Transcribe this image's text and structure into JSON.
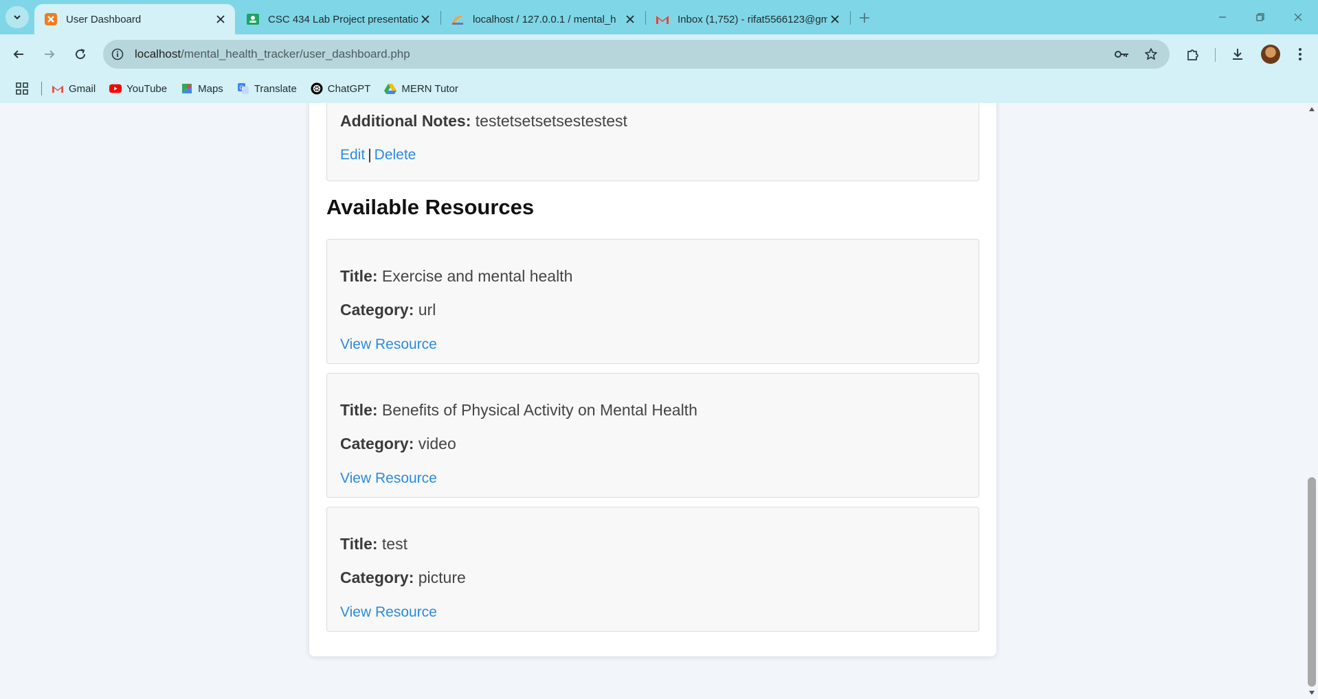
{
  "browser": {
    "tabs": [
      {
        "title": "User Dashboard",
        "icon": "xampp-icon",
        "active": true
      },
      {
        "title": "CSC 434 Lab Project presentatio",
        "icon": "google-classroom-icon",
        "active": false
      },
      {
        "title": "localhost / 127.0.0.1 / mental_h",
        "icon": "phpmyadmin-icon",
        "active": false
      },
      {
        "title": "Inbox (1,752) - rifat5566123@gm",
        "icon": "gmail-icon",
        "active": false
      }
    ],
    "url_host": "localhost",
    "url_path": "/mental_health_tracker/user_dashboard.php",
    "bookmarks": [
      {
        "label": "Gmail",
        "icon": "gmail-icon"
      },
      {
        "label": "YouTube",
        "icon": "youtube-icon"
      },
      {
        "label": "Maps",
        "icon": "maps-icon"
      },
      {
        "label": "Translate",
        "icon": "translate-icon"
      },
      {
        "label": "ChatGPT",
        "icon": "chatgpt-icon"
      },
      {
        "label": "MERN Tutor",
        "icon": "drive-icon"
      }
    ]
  },
  "mood_entry": {
    "notes_label": "Additional Notes:",
    "notes_value": "testetsetsetsestestest",
    "edit_label": "Edit",
    "separator": "|",
    "delete_label": "Delete"
  },
  "resources_section": {
    "heading": "Available Resources",
    "title_label": "Title:",
    "category_label": "Category:",
    "link_label": "View Resource",
    "items": [
      {
        "title": "Exercise and mental health",
        "category": "url"
      },
      {
        "title": "Benefits of Physical Activity on Mental Health",
        "category": "video"
      },
      {
        "title": "test",
        "category": "picture"
      }
    ]
  },
  "colors": {
    "link": "#2a8be0",
    "tab_strip": "#7fd6e6",
    "toolbar": "#d3f1f6",
    "page_bg": "#f2f5fa"
  }
}
